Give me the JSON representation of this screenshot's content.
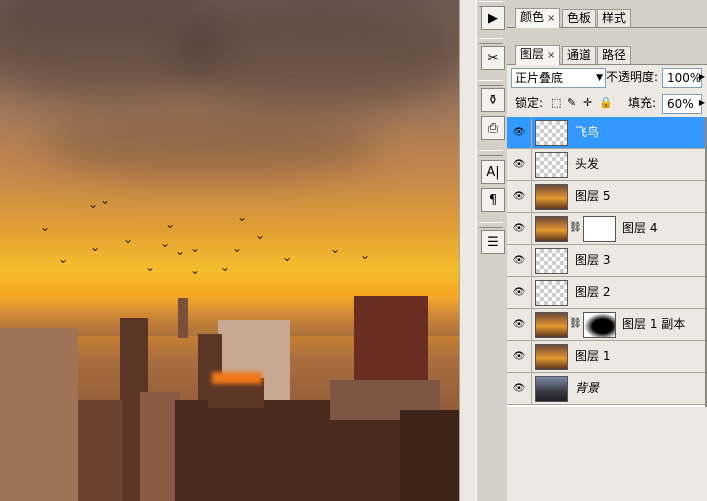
{
  "panel_tabs_top": [
    {
      "label": "颜色",
      "closable": true,
      "active": true
    },
    {
      "label": "色板",
      "closable": false,
      "active": false
    },
    {
      "label": "样式",
      "closable": false,
      "active": false
    }
  ],
  "panel_tabs_layers": [
    {
      "label": "图层",
      "closable": true,
      "active": true
    },
    {
      "label": "通道",
      "closable": false,
      "active": false
    },
    {
      "label": "路径",
      "closable": false,
      "active": false
    }
  ],
  "close_glyph": "×",
  "blend_mode": {
    "value": "正片叠底"
  },
  "opacity": {
    "label": "不透明度:",
    "value": "100%"
  },
  "lock": {
    "label": "锁定:"
  },
  "fill": {
    "label": "填充:",
    "value": "60%"
  },
  "layers": [
    {
      "name": "飞鸟",
      "selected": true,
      "thumb": "checker",
      "mask": false
    },
    {
      "name": "头发",
      "selected": false,
      "thumb": "checker",
      "mask": false
    },
    {
      "name": "图层 5",
      "selected": false,
      "thumb": "sunset",
      "mask": false
    },
    {
      "name": "图层 4",
      "selected": false,
      "thumb": "sunset",
      "mask": "white"
    },
    {
      "name": "图层 3",
      "selected": false,
      "thumb": "checker",
      "mask": false
    },
    {
      "name": "图层 2",
      "selected": false,
      "thumb": "checker",
      "mask": false
    },
    {
      "name": "图层 1 副本",
      "selected": false,
      "thumb": "sunset",
      "mask": "black"
    },
    {
      "name": "图层 1",
      "selected": false,
      "thumb": "sunset",
      "mask": false
    },
    {
      "name": "背景",
      "selected": false,
      "thumb": "night",
      "mask": false,
      "italic": true
    }
  ],
  "colors": {
    "selection": "#3399ff",
    "panel_bg": "#d4d0c8"
  },
  "tool_icons": [
    "play-icon",
    "tools-icon",
    "brush-icon",
    "stamp-icon",
    "text-icon",
    "paragraph-icon",
    "notes-icon"
  ]
}
